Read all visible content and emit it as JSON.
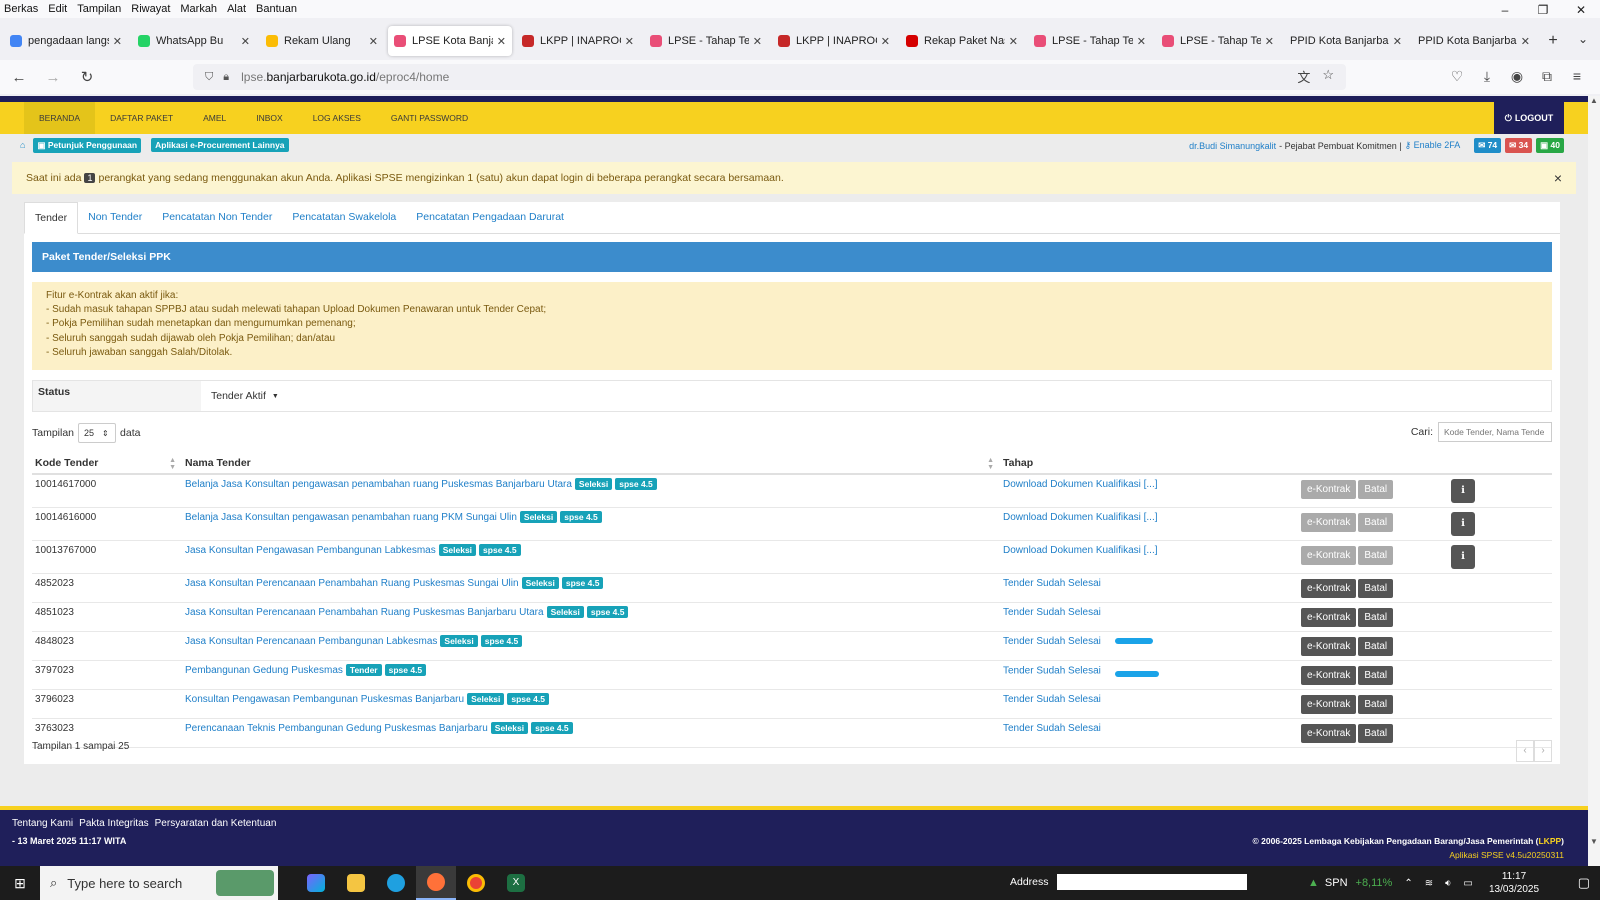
{
  "browser": {
    "menu": [
      "Berkas",
      "Edit",
      "Tampilan",
      "Riwayat",
      "Markah",
      "Alat",
      "Bantuan"
    ],
    "window_controls": [
      "–",
      "❐",
      "✕"
    ],
    "tabs": [
      {
        "label": "pengadaan langsu",
        "icon_color": "#4285f4",
        "icon": "google-icon"
      },
      {
        "label": "WhatsApp Bu",
        "icon_color": "#25d366",
        "icon": "whatsapp-icon"
      },
      {
        "label": "Rekam Ulang",
        "icon_color": "#fbbc05",
        "icon": "drive-icon"
      },
      {
        "label": "LPSE Kota Banjarb",
        "icon_color": "#e94e77",
        "icon": "lpse-icon",
        "active": true
      },
      {
        "label": "LKPP | INAPROC",
        "icon_color": "#c62828",
        "icon": "lkpp-icon"
      },
      {
        "label": "LPSE - Tahap Tend",
        "icon_color": "#e94e77",
        "icon": "lpse-icon"
      },
      {
        "label": "LKPP | INAPROC",
        "icon_color": "#c62828",
        "icon": "lkpp-icon"
      },
      {
        "label": "Rekap Paket Nasio",
        "icon_color": "#d50000",
        "icon": "arrow-icon"
      },
      {
        "label": "LPSE - Tahap Tend",
        "icon_color": "#e94e77",
        "icon": "lpse-icon"
      },
      {
        "label": "LPSE - Tahap Tend",
        "icon_color": "#e94e77",
        "icon": "lpse-icon"
      },
      {
        "label": "PPID Kota Banjarbaru",
        "icon_color": "",
        "icon": ""
      },
      {
        "label": "PPID Kota Banjarbaru",
        "icon_color": "",
        "icon": ""
      }
    ],
    "url_prefix": "lpse.",
    "url_domain": "banjarbarukota.go.id",
    "url_path": "/eproc4/home"
  },
  "app": {
    "nav": [
      "BERANDA",
      "DAFTAR PAKET",
      "AMEL",
      "INBOX",
      "LOG AKSES",
      "GANTI PASSWORD"
    ],
    "logout": "LOGOUT",
    "pills": [
      "Petunjuk Penggunaan",
      "Aplikasi e-Procurement Lainnya"
    ],
    "user_name": "dr.Budi Simanungkalit",
    "user_role": "- Pejabat Pembuat Komitmen |",
    "enable_2fa": "Enable 2FA",
    "badges": [
      {
        "value": "74",
        "color": "#1f8dc8",
        "icon": "mail-icon"
      },
      {
        "value": "34",
        "color": "#d9534f",
        "icon": "mail-icon"
      },
      {
        "value": "40",
        "color": "#28a745",
        "icon": "inbox-icon"
      }
    ],
    "alert_pre": "Saat ini ada",
    "alert_count": "1",
    "alert_post": "perangkat yang sedang menggunakan akun Anda. Aplikasi SPSE mengizinkan 1 (satu) akun dapat login di beberapa perangkat secara bersamaan.",
    "content_tabs": [
      "Tender",
      "Non Tender",
      "Pencatatan Non Tender",
      "Pencatatan Swakelola",
      "Pencatatan Pengadaan Darurat"
    ],
    "panel_title": "Paket Tender/Seleksi PPK",
    "notice": [
      "Fitur e-Kontrak akan aktif jika:",
      "- Sudah masuk tahapan SPPBJ atau sudah melewati tahapan Upload Dokumen Penawaran untuk Tender Cepat;",
      "- Pokja Pemilihan sudah menetapkan dan mengumumkan pemenang;",
      "- Seluruh sanggah sudah dijawab oleh Pokja Pemilihan; dan/atau",
      "- Seluruh jawaban sanggah Salah/Ditolak."
    ],
    "status_label": "Status",
    "status_value": "Tender Aktif",
    "show_label": "Tampilan",
    "per_page": "25",
    "data_label": "data",
    "search_label": "Cari:",
    "search_placeholder": "Kode Tender, Nama Tende",
    "columns": [
      "Kode Tender",
      "Nama Tender",
      "Tahap"
    ],
    "rows": [
      {
        "kode": "10014617000",
        "nama": "Belanja Jasa Konsultan pengawasan penambahan ruang Puskesmas Banjarbaru Utara",
        "jenis": "Seleksi",
        "versi": "spse 4.5",
        "tahap": "Download Dokumen Kualifikasi [...]",
        "active": false,
        "info": true,
        "mark": 0
      },
      {
        "kode": "10014616000",
        "nama": "Belanja Jasa Konsultan pengawasan penambahan ruang PKM Sungai Ulin",
        "jenis": "Seleksi",
        "versi": "spse 4.5",
        "tahap": "Download Dokumen Kualifikasi [...]",
        "active": false,
        "info": true,
        "mark": 0
      },
      {
        "kode": "10013767000",
        "nama": "Jasa Konsultan Pengawasan Pembangunan Labkesmas",
        "jenis": "Seleksi",
        "versi": "spse 4.5",
        "tahap": "Download Dokumen Kualifikasi [...]",
        "active": false,
        "info": true,
        "mark": 0
      },
      {
        "kode": "4852023",
        "nama": "Jasa Konsultan Perencanaan Penambahan Ruang Puskesmas Sungai Ulin",
        "jenis": "Seleksi",
        "versi": "spse 4.5",
        "tahap": "Tender Sudah Selesai",
        "active": true,
        "info": false,
        "mark": 0
      },
      {
        "kode": "4851023",
        "nama": "Jasa Konsultan Perencanaan Penambahan Ruang Puskesmas Banjarbaru Utara",
        "jenis": "Seleksi",
        "versi": "spse 4.5",
        "tahap": "Tender Sudah Selesai",
        "active": true,
        "info": false,
        "mark": 0
      },
      {
        "kode": "4848023",
        "nama": "Jasa Konsultan Perencanaan Pembangunan Labkesmas",
        "jenis": "Seleksi",
        "versi": "spse 4.5",
        "tahap": "Tender Sudah Selesai",
        "active": true,
        "info": false,
        "mark": 1
      },
      {
        "kode": "3797023",
        "nama": "Pembangunan Gedung Puskesmas",
        "jenis": "Tender",
        "versi": "spse 4.5",
        "tahap": "Tender Sudah Selesai",
        "active": true,
        "info": false,
        "mark": 2
      },
      {
        "kode": "3796023",
        "nama": "Konsultan Pengawasan Pembangunan Puskesmas Banjarbaru",
        "jenis": "Seleksi",
        "versi": "spse 4.5",
        "tahap": "Tender Sudah Selesai",
        "active": true,
        "info": false,
        "mark": 0
      },
      {
        "kode": "3763023",
        "nama": "Perencanaan Teknis Pembangunan Gedung Puskesmas Banjarbaru",
        "jenis": "Seleksi",
        "versi": "spse 4.5",
        "tahap": "Tender Sudah Selesai",
        "active": true,
        "info": false,
        "mark": 0
      }
    ],
    "btn_kontrak": "e-Kontrak",
    "btn_batal": "Batal",
    "showing": "Tampilan 1 sampai 25",
    "footer_links": [
      "Tentang Kami",
      "Pakta Integritas",
      "Persyaratan dan Ketentuan"
    ],
    "footer_date": "- 13 Maret 2025 11:17 WITA",
    "footer_copy": "© 2006-2025 Lembaga Kebijakan Pengadaan Barang/Jasa Pemerintah (",
    "footer_copy_link": "LKPP",
    "footer_copy_end": ")",
    "footer_version": "Aplikasi SPSE v4.5u20250311"
  },
  "taskbar": {
    "search_placeholder": "Type here to search",
    "address_label": "Address",
    "ticker": "SPN",
    "ticker_change": "+8,11%",
    "time": "11:17",
    "date": "13/03/2025"
  }
}
